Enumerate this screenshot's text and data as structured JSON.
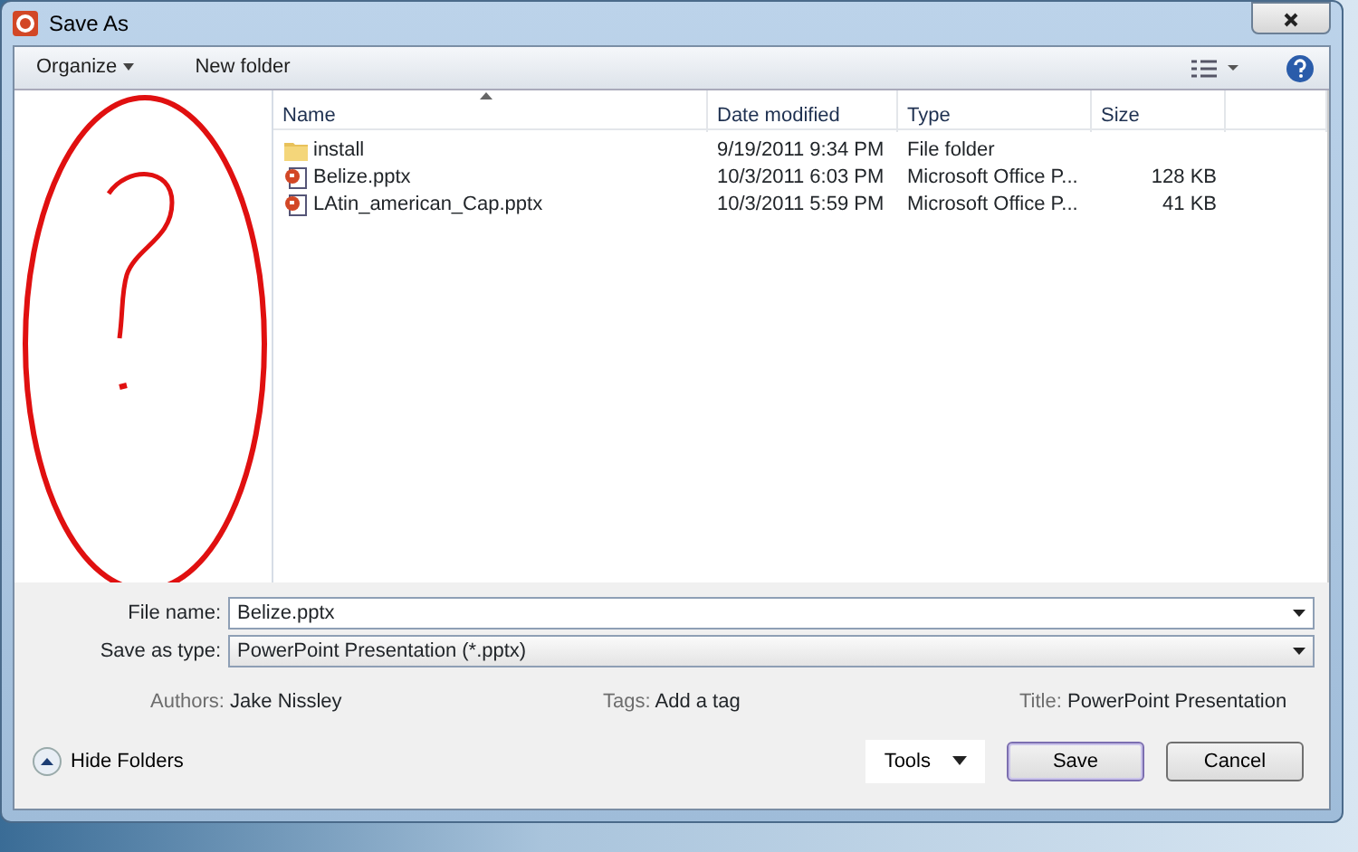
{
  "window": {
    "title": "Save As"
  },
  "toolbar": {
    "organize": "Organize",
    "new_folder": "New folder"
  },
  "table": {
    "columns": [
      "Name",
      "Date modified",
      "Type",
      "Size"
    ],
    "rows": [
      {
        "kind": "folder",
        "name": "install",
        "date": "9/19/2011 9:34 PM",
        "type": "File folder",
        "size": ""
      },
      {
        "kind": "pptx",
        "name": "Belize.pptx",
        "date": "10/3/2011 6:03 PM",
        "type": "Microsoft Office P...",
        "size": "128 KB"
      },
      {
        "kind": "pptx",
        "name": "LAtin_american_Cap.pptx",
        "date": "10/3/2011 5:59 PM",
        "type": "Microsoft Office P...",
        "size": "41 KB"
      }
    ]
  },
  "form": {
    "file_name_label": "File name:",
    "file_name": "Belize.pptx",
    "type_label": "Save as type:",
    "type": "PowerPoint Presentation (*.pptx)"
  },
  "meta": [
    {
      "label": "Authors:",
      "value": "Jake Nissley"
    },
    {
      "label": "Tags:",
      "value": "Add a tag"
    },
    {
      "label": "Title:",
      "value": "PowerPoint Presentation"
    }
  ],
  "footer": {
    "hide_folders": "Hide Folders",
    "tools": "Tools",
    "save": "Save",
    "cancel": "Cancel"
  }
}
